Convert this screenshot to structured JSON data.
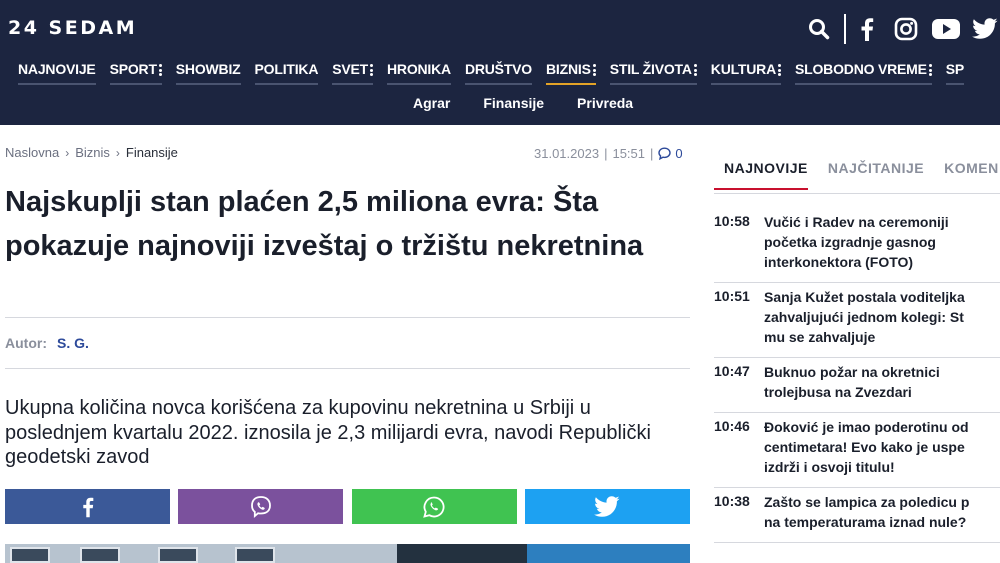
{
  "header": {
    "logo": "24 SEDAM",
    "social_icons": [
      "search-icon",
      "facebook-icon",
      "instagram-icon",
      "youtube-icon",
      "twitter-icon"
    ],
    "nav": [
      {
        "label": "NAJNOVIJE",
        "has_menu": false
      },
      {
        "label": "SPORT",
        "has_menu": true
      },
      {
        "label": "SHOWBIZ",
        "has_menu": false
      },
      {
        "label": "POLITIKA",
        "has_menu": false
      },
      {
        "label": "SVET",
        "has_menu": true
      },
      {
        "label": "HRONIKA",
        "has_menu": false
      },
      {
        "label": "DRUŠTVO",
        "has_menu": false
      },
      {
        "label": "BIZNIS",
        "has_menu": true,
        "active": true
      },
      {
        "label": "STIL ŽIVOTA",
        "has_menu": true
      },
      {
        "label": "KULTURA",
        "has_menu": true
      },
      {
        "label": "SLOBODNO VREME",
        "has_menu": true
      },
      {
        "label": "SP",
        "has_menu": false
      }
    ],
    "subnav": [
      "Agrar",
      "Finansije",
      "Privreda"
    ]
  },
  "breadcrumb": [
    "Naslovna",
    "Biznis",
    "Finansije"
  ],
  "meta": {
    "date": "31.01.2023",
    "time": "15:51",
    "comments": "0"
  },
  "article": {
    "title": "Najskuplji stan plaćen 2,5 miliona evra: Šta pokazuje najnoviji izveštaj o tržištu nekretnina",
    "author_label": "Autor:",
    "author": "S. G.",
    "lead": "Ukupna količina novca korišćena za kupovinu nekretnina u Srbiji u poslednjem kvartalu 2022. iznosila je 2,3 milijardi evra, navodi Republički geodetski zavod"
  },
  "share": [
    "facebook-icon",
    "viber-icon",
    "whatsapp-icon",
    "twitter-icon"
  ],
  "colors": {
    "header_bg": "#1c2540",
    "active_nav": "#e3a327",
    "active_tab": "#c8102e",
    "link": "#2d4a9a"
  },
  "sidebar": {
    "tabs": [
      "NAJNOVIJE",
      "NAJČITANIJE",
      "KOMEN"
    ],
    "news": [
      {
        "time": "10:58",
        "text": "Vučić i Radev na ceremoniji\npočetka izgradnje gasnog\ninterkonektora (FOTO)"
      },
      {
        "time": "10:51",
        "text": "Sanja Kužet postala voditeljka\nzahvaljujući jednom kolegi: St\nmu se zahvaljuje"
      },
      {
        "time": "10:47",
        "text": "Buknuo požar na okretnici\ntrolejbusa na Zvezdari"
      },
      {
        "time": "10:46",
        "text": "Đoković je imao poderotinu od\ncentimetara! Evo kako je uspe\nizdrži i osvoji titulu!"
      },
      {
        "time": "10:38",
        "text": "Zašto se lampica za poledicu p\nna temperaturama iznad nule?"
      }
    ]
  }
}
